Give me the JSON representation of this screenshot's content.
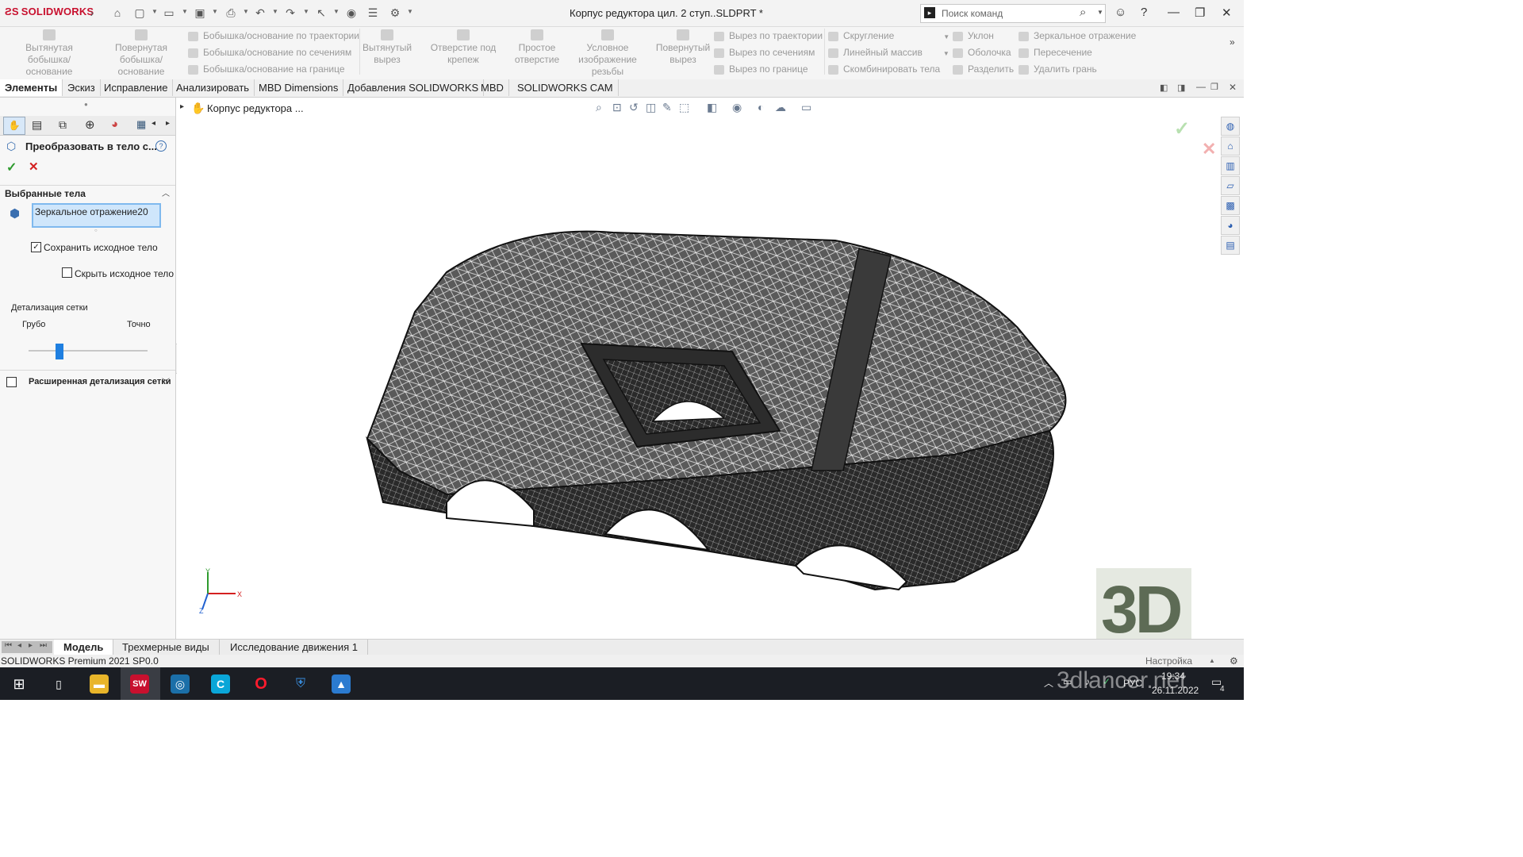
{
  "titlebar": {
    "brand": "SOLIDWORKS",
    "document_title": "Корпус редуктора цил. 2 ступ..SLDPRT *",
    "search_placeholder": "Поиск команд"
  },
  "command_manager": {
    "big_buttons": [
      {
        "label": "Вытянутая бобышка/основание"
      },
      {
        "label": "Повернутая бобышка/основание"
      },
      {
        "label": "Вытянутый вырез"
      },
      {
        "label": "Отверстие под крепеж"
      },
      {
        "label": "Простое отверстие"
      },
      {
        "label": "Условное изображение резьбы"
      },
      {
        "label": "Повернутый вырез"
      }
    ],
    "group1": [
      "Бобышка/основание по траектории",
      "Бобышка/основание по сечениям",
      "Бобышка/основание на границе"
    ],
    "group2": [
      "Вырез по траектории",
      "Вырез по сечениям",
      "Вырез по границе"
    ],
    "group3": [
      "Скругление",
      "Линейный массив",
      "Скомбинировать тела"
    ],
    "group4": [
      "Уклон",
      "Оболочка",
      "Разделить"
    ],
    "group5": [
      "Зеркальное отражение",
      "Пересечение",
      "Удалить грань"
    ]
  },
  "tabs": [
    {
      "label": "Элементы",
      "active": true
    },
    {
      "label": "Эскиз"
    },
    {
      "label": "Исправление"
    },
    {
      "label": "Анализировать"
    },
    {
      "label": "MBD Dimensions"
    },
    {
      "label": "Добавления SOLIDWORKS"
    },
    {
      "label": "MBD"
    },
    {
      "label": "SOLIDWORKS CAM"
    }
  ],
  "property_manager": {
    "title": "Преобразовать в тело с...",
    "section_selected": "Выбранные тела",
    "selected_body": "Зеркальное отражение20",
    "keep_original": {
      "label": "Сохранить исходное тело",
      "checked": true
    },
    "hide_original": {
      "label": "Скрыть исходное тело",
      "checked": false
    },
    "mesh_detail_label": "Детализация сетки",
    "coarse": "Грубо",
    "fine": "Точно",
    "slider_fraction": 0.26,
    "advanced": {
      "label": "Расширенная детализация сетки",
      "checked": false
    }
  },
  "viewport": {
    "tree_root": "Корпус редуктора ...",
    "triad": {
      "x": "X",
      "y": "Y",
      "z": "Z"
    }
  },
  "bottom_tabs": [
    {
      "label": "Модель",
      "active": true
    },
    {
      "label": "Трехмерные виды"
    },
    {
      "label": "Исследование движения 1"
    }
  ],
  "status": {
    "version": "SOLIDWORKS Premium 2021 SP0.0",
    "customize": "Настройка"
  },
  "taskbar": {
    "lang": "РУС",
    "time": "19:34",
    "date": "26.11.2022",
    "notifications": "4"
  },
  "watermark": {
    "logo": "3D",
    "site": "3dlancer.net"
  },
  "colors": {
    "accent": "#1f7fe0",
    "brand": "#c8102e",
    "mesh": "#111111",
    "ok": "#2e9b2e",
    "cancel": "#d42020"
  }
}
